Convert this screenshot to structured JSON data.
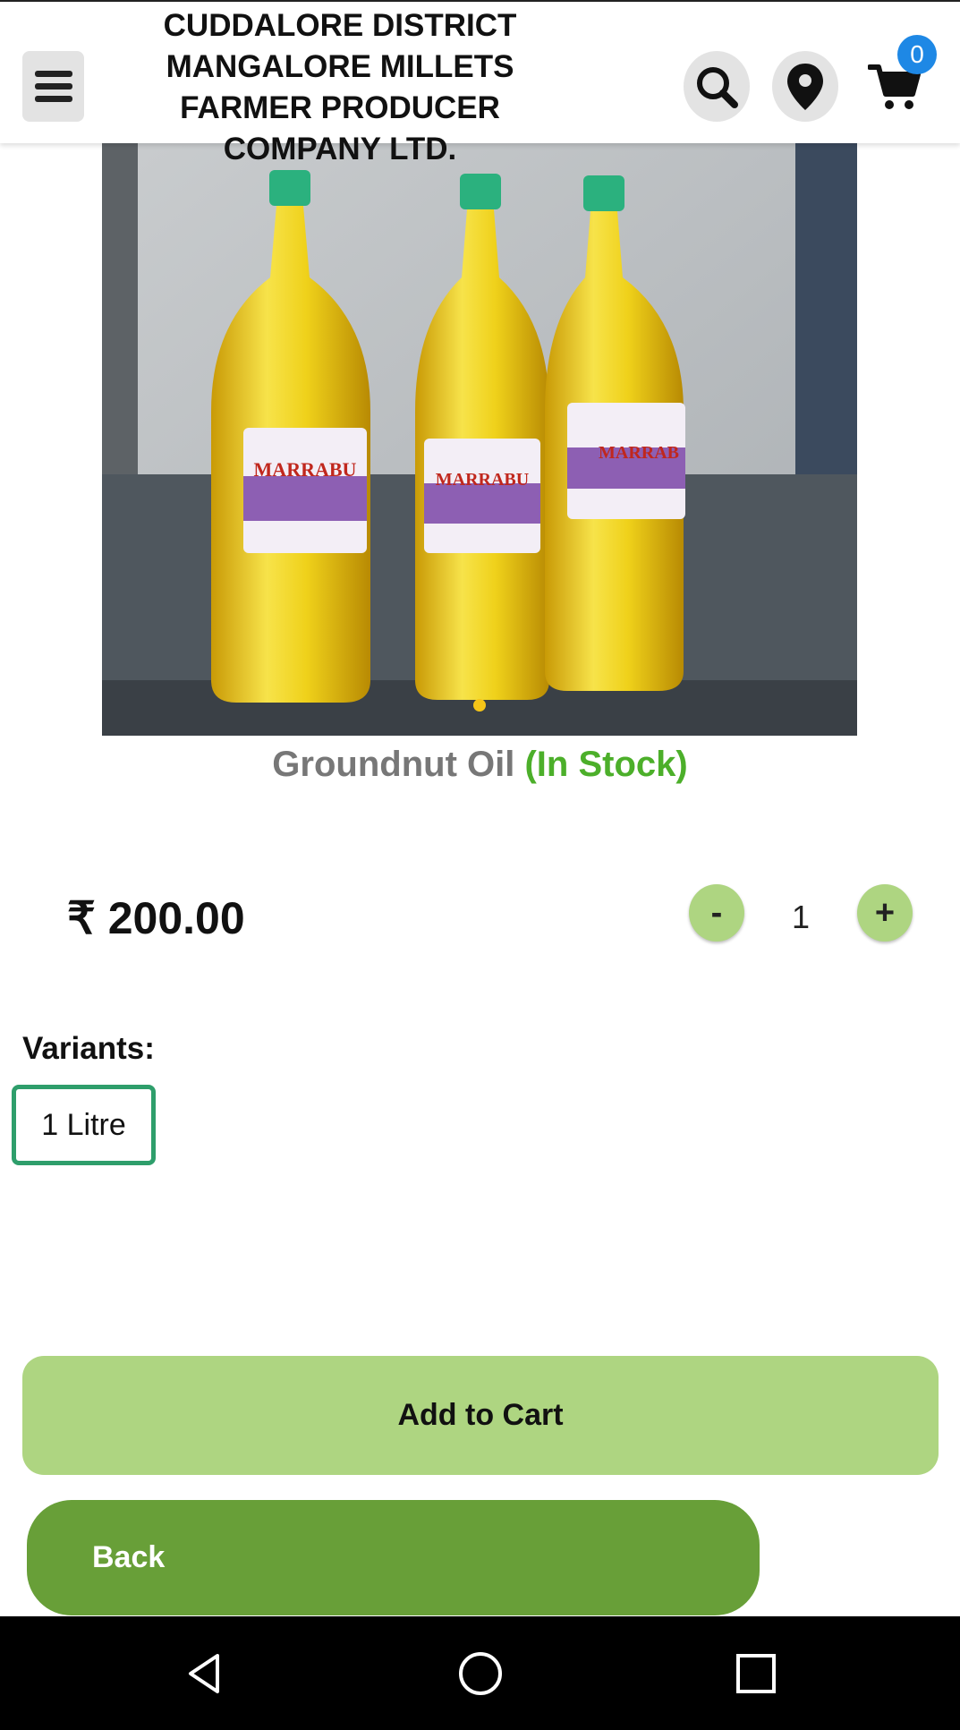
{
  "header": {
    "company_name": "CUDDALORE DISTRICT MANGALORE MILLETS FARMER PRODUCER COMPANY LTD.",
    "cart_count": "0",
    "icons": [
      "menu-icon",
      "search-icon",
      "location-pin-icon",
      "cart-icon"
    ]
  },
  "carousel": {
    "image_alt": "Groundnut Oil bottles",
    "label_text": "MARRABU",
    "active_index": 1,
    "total": 1
  },
  "product": {
    "name": "Groundnut Oil",
    "stock_status": "(In Stock)",
    "price": "₹ 200.00",
    "quantity": "1",
    "minus_label": "-",
    "plus_label": "+"
  },
  "variants": {
    "label": "Variants:",
    "options": [
      "1 Litre"
    ],
    "selected": "1 Litre"
  },
  "actions": {
    "add_to_cart": "Add to Cart",
    "back": "Back"
  },
  "colors": {
    "accent_light_green": "#aed581",
    "accent_dark_green": "#689f38",
    "stock_green": "#4caf2a",
    "variant_border": "#2e9e6b",
    "badge_blue": "#1e88e5"
  },
  "system_nav": {
    "icons": [
      "back-triangle-icon",
      "home-circle-icon",
      "recents-square-icon"
    ]
  }
}
